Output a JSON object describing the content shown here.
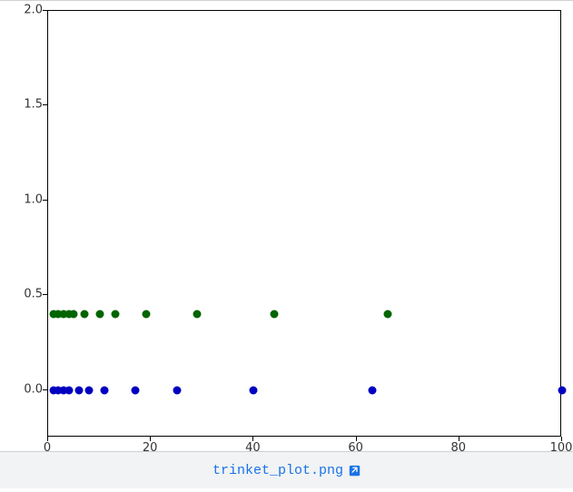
{
  "chart_data": {
    "type": "scatter",
    "title": "",
    "xlabel": "",
    "ylabel": "",
    "xlim": [
      0,
      100
    ],
    "ylim": [
      -0.25,
      2.0
    ],
    "xticks": [
      0,
      20,
      40,
      60,
      80,
      100
    ],
    "yticks": [
      0.0,
      0.5,
      1.0,
      1.5,
      2.0
    ],
    "series": [
      {
        "name": "blue",
        "color": "#0000c0",
        "points": [
          {
            "x": 1,
            "y": 0.0
          },
          {
            "x": 2,
            "y": 0.0
          },
          {
            "x": 3,
            "y": 0.0
          },
          {
            "x": 4,
            "y": 0.0
          },
          {
            "x": 6,
            "y": 0.0
          },
          {
            "x": 8,
            "y": 0.0
          },
          {
            "x": 11,
            "y": 0.0
          },
          {
            "x": 17,
            "y": 0.0
          },
          {
            "x": 25,
            "y": 0.0
          },
          {
            "x": 40,
            "y": 0.0
          },
          {
            "x": 63,
            "y": 0.0
          },
          {
            "x": 100,
            "y": 0.0
          }
        ]
      },
      {
        "name": "green",
        "color": "#006400",
        "points": [
          {
            "x": 1,
            "y": 0.4
          },
          {
            "x": 2,
            "y": 0.4
          },
          {
            "x": 3,
            "y": 0.4
          },
          {
            "x": 4,
            "y": 0.4
          },
          {
            "x": 5,
            "y": 0.4
          },
          {
            "x": 7,
            "y": 0.4
          },
          {
            "x": 10,
            "y": 0.4
          },
          {
            "x": 13,
            "y": 0.4
          },
          {
            "x": 19,
            "y": 0.4
          },
          {
            "x": 29,
            "y": 0.4
          },
          {
            "x": 44,
            "y": 0.4
          },
          {
            "x": 66,
            "y": 0.4
          }
        ]
      }
    ]
  },
  "filename": "trinket_plot.png",
  "icon_title": "open-external-icon"
}
